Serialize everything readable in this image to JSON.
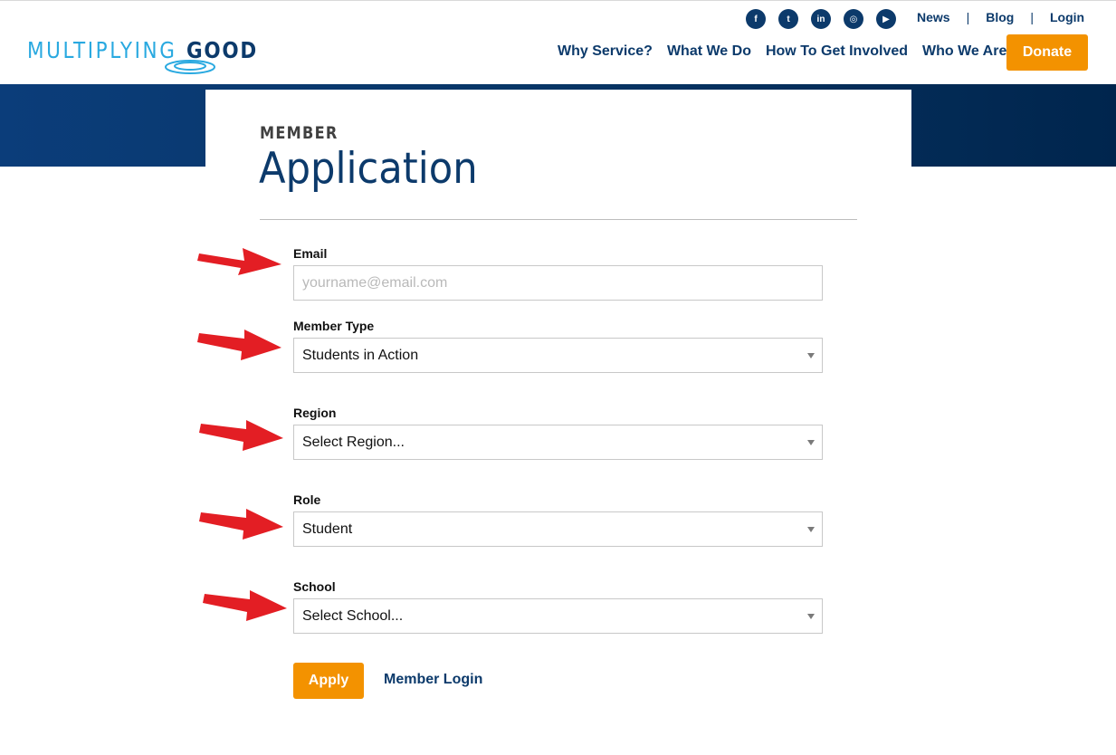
{
  "brand": {
    "logo_part1": "MULTIPLYING",
    "logo_part2": "GOOD",
    "primary_color": "#0c3a6b",
    "accent_color": "#f39200",
    "logo_light_color": "#29a9e0"
  },
  "social": [
    {
      "icon": "facebook-icon",
      "glyph": "f"
    },
    {
      "icon": "twitter-icon",
      "glyph": "t"
    },
    {
      "icon": "linkedin-icon",
      "glyph": "in"
    },
    {
      "icon": "instagram-icon",
      "glyph": "◎"
    },
    {
      "icon": "youtube-icon",
      "glyph": "▶"
    }
  ],
  "util_nav": {
    "news": "News",
    "blog": "Blog",
    "login": "Login",
    "separator": "|"
  },
  "main_nav": {
    "why_service": "Why Service?",
    "what_we_do": "What We Do",
    "how_to_get_involved": "How To Get Involved",
    "who_we_are": "Who We Are"
  },
  "donate_label": "Donate",
  "page": {
    "kicker": "MEMBER",
    "title": "Application"
  },
  "form": {
    "email": {
      "label": "Email",
      "placeholder": "yourname@email.com",
      "value": ""
    },
    "member_type": {
      "label": "Member Type",
      "value": "Students in Action"
    },
    "region": {
      "label": "Region",
      "value": "Select Region..."
    },
    "role": {
      "label": "Role",
      "value": "Student"
    },
    "school": {
      "label": "School",
      "value": "Select School..."
    },
    "apply_label": "Apply",
    "member_login_label": "Member Login"
  },
  "annotation_color": "#e31e24"
}
